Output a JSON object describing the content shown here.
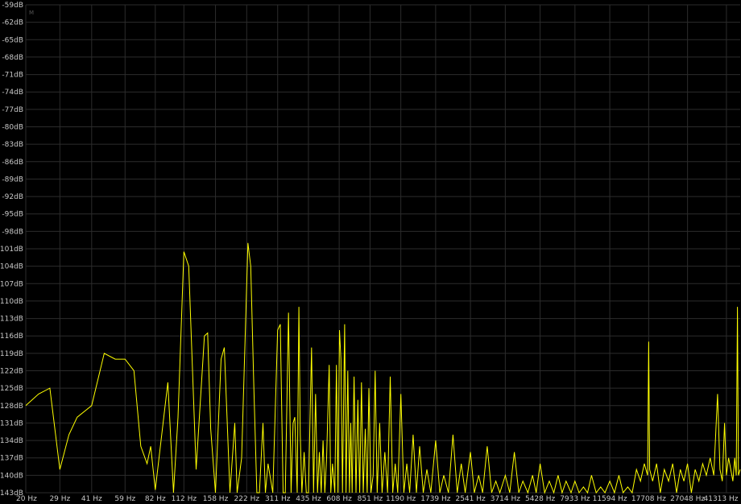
{
  "corner_label": "M",
  "colors": {
    "background": "#000000",
    "grid": "#2c2c2c",
    "trace": "#ffff00",
    "text": "#c8c8c8"
  },
  "chart_data": {
    "type": "line",
    "title": "",
    "xlabel": "",
    "ylabel": "",
    "x_scale": "log",
    "xlim": [
      20,
      48000
    ],
    "ylim": [
      -143,
      -59
    ],
    "grid": true,
    "y_ticks": [
      "-59dB",
      "-62dB",
      "-65dB",
      "-68dB",
      "-71dB",
      "-74dB",
      "-77dB",
      "-80dB",
      "-83dB",
      "-86dB",
      "-89dB",
      "-92dB",
      "-95dB",
      "-98dB",
      "-101dB",
      "-104dB",
      "-107dB",
      "-110dB",
      "-113dB",
      "-116dB",
      "-119dB",
      "-122dB",
      "-125dB",
      "-128dB",
      "-131dB",
      "-134dB",
      "-137dB",
      "-140dB",
      "-143dB"
    ],
    "y_tick_values": [
      -59,
      -62,
      -65,
      -68,
      -71,
      -74,
      -77,
      -80,
      -83,
      -86,
      -89,
      -92,
      -95,
      -98,
      -101,
      -104,
      -107,
      -110,
      -113,
      -116,
      -119,
      -122,
      -125,
      -128,
      -131,
      -134,
      -137,
      -140,
      -143
    ],
    "x_ticks": [
      "20 Hz",
      "29 Hz",
      "41 Hz",
      "59 Hz",
      "82 Hz",
      "112 Hz",
      "158 Hz",
      "222 Hz",
      "311 Hz",
      "435 Hz",
      "608 Hz",
      "851 Hz",
      "1190 Hz",
      "1739 Hz",
      "2541 Hz",
      "3714 Hz",
      "5428 Hz",
      "7933 Hz",
      "11594 Hz",
      "17708 Hz",
      "27048 Hz",
      "41313 Hz"
    ],
    "x_tick_values": [
      20,
      29,
      41,
      59,
      82,
      112,
      158,
      222,
      311,
      435,
      608,
      851,
      1190,
      1739,
      2541,
      3714,
      5428,
      7933,
      11594,
      17708,
      27048,
      41313
    ],
    "series": [
      {
        "color": "#ffff00",
        "points": [
          [
            20,
            -128
          ],
          [
            23,
            -126
          ],
          [
            26,
            -125
          ],
          [
            29,
            -139
          ],
          [
            32,
            -133
          ],
          [
            35,
            -130
          ],
          [
            41,
            -128
          ],
          [
            47,
            -119
          ],
          [
            53,
            -120
          ],
          [
            59,
            -120
          ],
          [
            65,
            -122
          ],
          [
            70,
            -135
          ],
          [
            75,
            -138
          ],
          [
            78,
            -135
          ],
          [
            82,
            -142.5
          ],
          [
            88,
            -133
          ],
          [
            94,
            -124
          ],
          [
            100,
            -143
          ],
          [
            105,
            -130
          ],
          [
            112,
            -101.5
          ],
          [
            118,
            -104
          ],
          [
            128,
            -139
          ],
          [
            140,
            -116
          ],
          [
            145,
            -115.5
          ],
          [
            150,
            -132
          ],
          [
            158,
            -143
          ],
          [
            168,
            -120
          ],
          [
            174,
            -118
          ],
          [
            185,
            -143
          ],
          [
            195,
            -131
          ],
          [
            200,
            -143
          ],
          [
            210,
            -137
          ],
          [
            225,
            -100
          ],
          [
            232,
            -104
          ],
          [
            240,
            -125
          ],
          [
            248,
            -143
          ],
          [
            255,
            -143
          ],
          [
            265,
            -131
          ],
          [
            272,
            -143
          ],
          [
            280,
            -138
          ],
          [
            295,
            -143
          ],
          [
            311,
            -115
          ],
          [
            320,
            -114
          ],
          [
            330,
            -143
          ],
          [
            338,
            -143
          ],
          [
            350,
            -112
          ],
          [
            360,
            -143
          ],
          [
            368,
            -131
          ],
          [
            375,
            -130
          ],
          [
            385,
            -143
          ],
          [
            392,
            -111
          ],
          [
            398,
            -133
          ],
          [
            405,
            -143
          ],
          [
            415,
            -136
          ],
          [
            425,
            -143
          ],
          [
            435,
            -143
          ],
          [
            450,
            -118
          ],
          [
            460,
            -143
          ],
          [
            470,
            -126
          ],
          [
            480,
            -143
          ],
          [
            490,
            -136
          ],
          [
            500,
            -143
          ],
          [
            510,
            -134
          ],
          [
            520,
            -143
          ],
          [
            530,
            -137
          ],
          [
            545,
            -121
          ],
          [
            555,
            -143
          ],
          [
            565,
            -138
          ],
          [
            580,
            -143
          ],
          [
            590,
            -121
          ],
          [
            600,
            -143
          ],
          [
            610,
            -115
          ],
          [
            620,
            -120
          ],
          [
            630,
            -143
          ],
          [
            645,
            -114
          ],
          [
            655,
            -143
          ],
          [
            668,
            -122
          ],
          [
            680,
            -143
          ],
          [
            690,
            -131
          ],
          [
            700,
            -143
          ],
          [
            715,
            -123
          ],
          [
            730,
            -143
          ],
          [
            745,
            -127
          ],
          [
            760,
            -143
          ],
          [
            775,
            -124
          ],
          [
            790,
            -143
          ],
          [
            808,
            -132
          ],
          [
            825,
            -143
          ],
          [
            840,
            -125
          ],
          [
            860,
            -143
          ],
          [
            880,
            -140
          ],
          [
            900,
            -122
          ],
          [
            920,
            -143
          ],
          [
            945,
            -131
          ],
          [
            970,
            -143
          ],
          [
            1000,
            -136
          ],
          [
            1030,
            -143
          ],
          [
            1060,
            -123
          ],
          [
            1090,
            -143
          ],
          [
            1120,
            -138
          ],
          [
            1150,
            -143
          ],
          [
            1190,
            -126
          ],
          [
            1230,
            -143
          ],
          [
            1270,
            -138
          ],
          [
            1310,
            -143
          ],
          [
            1360,
            -133
          ],
          [
            1410,
            -143
          ],
          [
            1460,
            -135
          ],
          [
            1520,
            -143
          ],
          [
            1580,
            -139
          ],
          [
            1650,
            -143
          ],
          [
            1739,
            -134
          ],
          [
            1820,
            -143
          ],
          [
            1900,
            -140
          ],
          [
            2000,
            -143
          ],
          [
            2100,
            -133
          ],
          [
            2200,
            -143
          ],
          [
            2300,
            -138
          ],
          [
            2400,
            -143
          ],
          [
            2541,
            -136
          ],
          [
            2650,
            -143
          ],
          [
            2780,
            -140
          ],
          [
            2900,
            -143
          ],
          [
            3050,
            -135
          ],
          [
            3200,
            -143
          ],
          [
            3350,
            -141
          ],
          [
            3500,
            -143
          ],
          [
            3714,
            -140
          ],
          [
            3900,
            -143
          ],
          [
            4100,
            -136
          ],
          [
            4300,
            -143
          ],
          [
            4500,
            -141
          ],
          [
            4750,
            -143
          ],
          [
            5000,
            -140
          ],
          [
            5200,
            -143
          ],
          [
            5428,
            -138
          ],
          [
            5700,
            -143
          ],
          [
            6000,
            -141
          ],
          [
            6300,
            -143
          ],
          [
            6600,
            -140
          ],
          [
            6900,
            -143
          ],
          [
            7200,
            -141
          ],
          [
            7600,
            -143
          ],
          [
            7933,
            -141
          ],
          [
            8300,
            -143
          ],
          [
            8700,
            -142
          ],
          [
            9100,
            -143
          ],
          [
            9500,
            -140
          ],
          [
            10000,
            -143
          ],
          [
            10500,
            -142
          ],
          [
            11000,
            -143
          ],
          [
            11594,
            -141
          ],
          [
            12200,
            -143
          ],
          [
            12800,
            -140
          ],
          [
            13400,
            -143
          ],
          [
            14100,
            -142
          ],
          [
            14800,
            -143
          ],
          [
            15500,
            -139
          ],
          [
            16200,
            -141
          ],
          [
            16900,
            -138
          ],
          [
            17500,
            -140
          ],
          [
            17708,
            -117
          ],
          [
            17900,
            -139
          ],
          [
            18500,
            -141
          ],
          [
            19300,
            -138
          ],
          [
            20100,
            -143
          ],
          [
            21000,
            -139
          ],
          [
            22000,
            -141
          ],
          [
            23000,
            -138
          ],
          [
            24000,
            -143
          ],
          [
            25000,
            -139
          ],
          [
            26000,
            -141
          ],
          [
            27048,
            -138
          ],
          [
            28200,
            -143
          ],
          [
            29400,
            -139
          ],
          [
            30600,
            -141
          ],
          [
            31900,
            -138
          ],
          [
            33200,
            -140
          ],
          [
            34600,
            -137
          ],
          [
            36000,
            -140
          ],
          [
            37500,
            -126
          ],
          [
            38500,
            -139
          ],
          [
            39500,
            -141
          ],
          [
            40500,
            -131
          ],
          [
            41313,
            -140
          ],
          [
            42300,
            -137
          ],
          [
            43300,
            -139
          ],
          [
            44300,
            -141
          ],
          [
            45200,
            -137
          ],
          [
            46000,
            -140
          ],
          [
            46600,
            -111
          ],
          [
            47100,
            -140
          ],
          [
            48000,
            -139
          ]
        ]
      }
    ]
  }
}
